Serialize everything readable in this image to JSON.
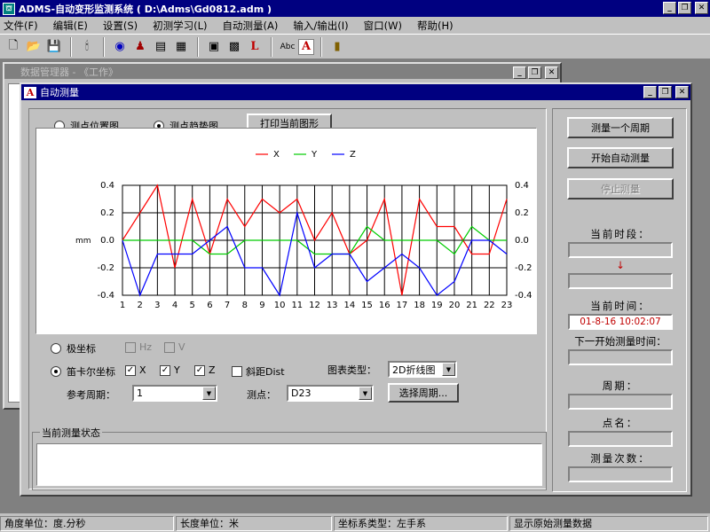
{
  "app": {
    "title": "ADMS-自动变形监测系统 ( D:\\Adms\\Gd0812.adm )"
  },
  "menu": [
    "文件(F)",
    "编辑(E)",
    "设置(S)",
    "初测学习(L)",
    "自动测量(A)",
    "输入/输出(I)",
    "窗口(W)",
    "帮助(H)"
  ],
  "toolbar_icons": [
    "new-file",
    "open-folder",
    "save-disk",
    "probe",
    "globe",
    "person",
    "grid",
    "table-xls",
    "document",
    "calculator",
    "red-L",
    "abc",
    "red-A",
    "book"
  ],
  "bg_window": {
    "title": "数据管理器 - 《工作》"
  },
  "auto_window": {
    "title": "自动测量",
    "view_radio_position": "测点位置图",
    "view_radio_trend": "测点趋势图",
    "print_button": "打印当前图形",
    "polar_radio": "极坐标",
    "hz_check": "Hz",
    "v_check": "V",
    "cartesian_radio": "笛卡尔坐标",
    "x_check": "X",
    "y_check": "Y",
    "z_check": "Z",
    "slope_check": "斜距Dist",
    "chart_type_label": "图表类型：",
    "chart_type_value": "2D折线图",
    "ref_period_label": "参考周期：",
    "ref_period_value": "1",
    "point_label": "测点：",
    "point_value": "D23",
    "select_period_button": "选择周期...",
    "status_group_label": "当前测量状态",
    "status_text": ""
  },
  "right_panel": {
    "measure_one_button": "测量一个周期",
    "start_auto_button": "开始自动测量",
    "stop_button": "停止测量",
    "current_period_label": "当前时段：",
    "arrow": "↓",
    "current_time_label": "当前时间：",
    "current_time_value": "01-8-16 10:02:07",
    "next_start_label": "下一开始测量时间：",
    "period_label": "周期：",
    "point_name_label": "点名：",
    "measure_count_label": "测量次数："
  },
  "status_bar": {
    "angle_unit": "角度单位：度.分秒",
    "length_unit": "长度单位：米",
    "coord_type": "坐标系类型：左手系",
    "display_mode": "显示原始测量数据"
  },
  "chart_data": {
    "type": "line",
    "x": [
      1,
      2,
      3,
      4,
      5,
      6,
      7,
      8,
      9,
      10,
      11,
      12,
      13,
      14,
      15,
      16,
      17,
      18,
      19,
      20,
      21,
      22,
      23
    ],
    "series": [
      {
        "name": "X",
        "color": "#ff0000",
        "values": [
          0.0,
          0.2,
          0.4,
          -0.2,
          0.3,
          -0.1,
          0.3,
          0.1,
          0.3,
          0.2,
          0.3,
          0.0,
          0.2,
          -0.1,
          0.0,
          0.3,
          -0.4,
          0.3,
          0.1,
          0.1,
          -0.1,
          -0.1,
          0.3
        ]
      },
      {
        "name": "Y",
        "color": "#00cc00",
        "values": [
          0.0,
          0.0,
          0.0,
          0.0,
          0.0,
          -0.1,
          -0.1,
          0.0,
          0.0,
          0.0,
          0.0,
          -0.1,
          -0.1,
          -0.1,
          0.1,
          0.0,
          0.0,
          0.0,
          0.0,
          -0.1,
          0.1,
          0.0,
          0.0
        ]
      },
      {
        "name": "Z",
        "color": "#0000ff",
        "values": [
          0.0,
          -0.4,
          -0.1,
          -0.1,
          -0.1,
          0.0,
          0.1,
          -0.2,
          -0.2,
          -0.4,
          0.2,
          -0.2,
          -0.1,
          -0.1,
          -0.3,
          -0.2,
          -0.1,
          -0.2,
          -0.4,
          -0.3,
          0.0,
          0.0,
          -0.1
        ]
      }
    ],
    "ylabel": "mm",
    "ylim": [
      -0.4,
      0.4
    ],
    "yticks": [
      "0.4",
      "0.2",
      "0.0",
      "-0.2",
      "-0.4"
    ],
    "grid": true,
    "legend": "top-center"
  }
}
